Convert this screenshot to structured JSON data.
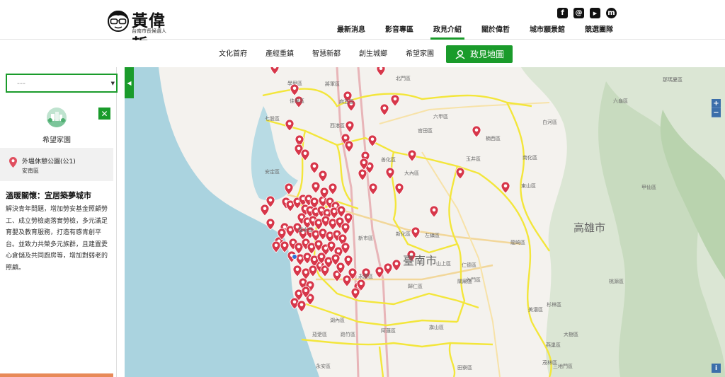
{
  "header": {
    "logo_name": "黃偉哲",
    "logo_sub": "台南市長候選人",
    "social": [
      {
        "icon": "facebook-icon",
        "glyph": "f"
      },
      {
        "icon": "email-icon",
        "glyph": "@"
      },
      {
        "icon": "youtube-icon",
        "glyph": "▶"
      },
      {
        "icon": "messenger-icon",
        "glyph": "m"
      }
    ],
    "nav": [
      {
        "label": "最新消息",
        "active": false
      },
      {
        "label": "影音專區",
        "active": false
      },
      {
        "label": "政見介紹",
        "active": true
      },
      {
        "label": "關於偉哲",
        "active": false
      },
      {
        "label": "城市願景館",
        "active": false
      },
      {
        "label": "競選團隊",
        "active": false
      }
    ]
  },
  "subnav": {
    "items": [
      "文化首府",
      "產經重鎮",
      "智慧新都",
      "創生城鄉",
      "希望家園"
    ],
    "active_label": "政見地圖"
  },
  "sidebar": {
    "select_value": "---",
    "category_title": "希望家園",
    "place": {
      "name": "外塭休憩公園(公1)",
      "district": "安南區"
    },
    "desc_title": "溫暖關懷：宜居築夢城市",
    "desc_body": "解決青年問題，增加勞安基金照顧勞工、成立勞檢處落實勞檢，多元滿足育嬰及教育服務，打造有感青創平台。並致力共榮多元族群，且建置愛心倉儲及共同廚房等，增加對弱老的照顧。"
  },
  "map": {
    "city_label": "臺南市",
    "neighbor_label": "高雄市",
    "district_labels": [
      "學甲區",
      "將軍區",
      "七股區",
      "佳里區",
      "麻豆區",
      "善化區",
      "新化區",
      "大內區",
      "玉井區",
      "楠西區",
      "南化區",
      "左鎮區",
      "歸仁區",
      "關廟區",
      "永康區",
      "六甲區",
      "官田區",
      "東山區",
      "白河區",
      "北門區",
      "安定區",
      "新市區",
      "山上區",
      "仁德區",
      "龍崎區",
      "內門區",
      "旗山區",
      "杉林區",
      "六龜區",
      "甲仙區",
      "桃源區",
      "茂林區",
      "美濃區",
      "田寮區",
      "阿蓮區",
      "湖內區",
      "茄萣區",
      "路竹區",
      "永安區",
      "燕巢區",
      "大樹區",
      "三地門區",
      "那瑪夏區",
      "西港區",
      "鹽水區"
    ],
    "zoom_in": "+",
    "zoom_out": "−",
    "info": "i",
    "colors": {
      "pin": "#d7374a",
      "boundary": "#f3e63b",
      "accent": "#1a9b2b"
    }
  }
}
